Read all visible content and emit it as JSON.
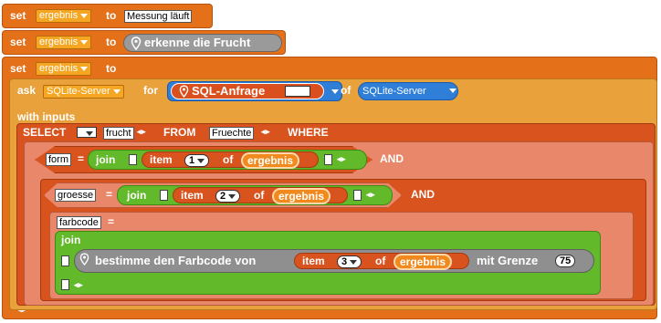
{
  "blocks": {
    "set1": {
      "set": "set",
      "var": "ergebnis",
      "to": "to",
      "value": "Messung läuft"
    },
    "set2": {
      "set": "set",
      "var": "ergebnis",
      "to": "to",
      "reporter": "erkenne die Frucht"
    },
    "set3": {
      "set": "set",
      "var": "ergebnis",
      "to": "to"
    },
    "ask": {
      "ask": "ask",
      "server": "SQLite-Server",
      "for": "for",
      "sql_label": "SQL-Anfrage",
      "of": "of",
      "of_server": "SQLite-Server",
      "with_inputs": "with inputs"
    },
    "select": {
      "select": "SELECT",
      "column": "frucht",
      "from": "FROM",
      "table": "Fruechte",
      "where": "WHERE"
    },
    "cond1": {
      "field": "form",
      "eq": "=",
      "join": "join",
      "item": "item",
      "index": "1",
      "of": "of",
      "list": "ergebnis",
      "and": "AND"
    },
    "cond2": {
      "field": "groesse",
      "eq": "=",
      "join": "join",
      "item": "item",
      "index": "2",
      "of": "of",
      "list": "ergebnis",
      "and": "AND"
    },
    "cond3": {
      "field": "farbcode",
      "eq": "=",
      "join": "join",
      "bestimme": "bestimme den Farbcode von",
      "item": "item",
      "index": "3",
      "of": "of",
      "list": "ergebnis",
      "mit_grenze": "mit Grenze",
      "grenze": "75"
    }
  },
  "arrows": "◂ ▸",
  "icons": [
    "location-pin-icon",
    "dropdown-arrow-icon",
    "left-right-arrows-icon"
  ],
  "colors": {
    "variables": "#e5701a",
    "operators": "#62b92a",
    "lists": "#d9531e",
    "sensing": "#2f90e0",
    "other": "#8a8a8a",
    "control": "#e9a23b"
  }
}
